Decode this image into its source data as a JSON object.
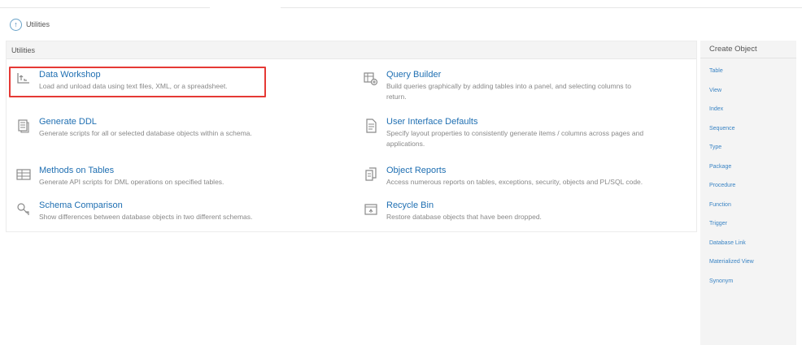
{
  "breadcrumb": {
    "label": "Utilities",
    "icon": "utilities-icon"
  },
  "panel": {
    "title": "Utilities",
    "items": [
      {
        "title": "Data Workshop",
        "desc1": "Load and unload data using text files, XML, or a spreadsheet.",
        "desc2": "",
        "icon": "data-workshop-icon",
        "highlighted": true
      },
      {
        "title": "Query Builder",
        "desc1": "Build queries graphically by adding tables into a panel, and selecting columns to",
        "desc2": "return.",
        "icon": "query-builder-icon"
      },
      {
        "title": "Generate DDL",
        "desc1": "Generate scripts for all or selected database objects within a schema.",
        "desc2": "",
        "icon": "generate-ddl-icon"
      },
      {
        "title": "User Interface Defaults",
        "desc1": "Specify layout properties to consistently generate items / columns across pages and",
        "desc2": "applications.",
        "icon": "ui-defaults-icon"
      },
      {
        "title": "Methods on Tables",
        "desc1": "Generate API scripts for DML operations on specified tables.",
        "desc2": "",
        "icon": "methods-on-tables-icon"
      },
      {
        "title": "Object Reports",
        "desc1": "Access numerous reports on tables, exceptions, security, objects and PL/SQL code.",
        "desc2": "",
        "icon": "object-reports-icon"
      },
      {
        "title": "Schema Comparison",
        "desc1": "Show differences between database objects in two different schemas.",
        "desc2": "",
        "icon": "schema-comparison-icon"
      },
      {
        "title": "Recycle Bin",
        "desc1": "Restore database objects that have been dropped.",
        "desc2": "",
        "icon": "recycle-bin-icon"
      }
    ]
  },
  "sidebar": {
    "title": "Create Object",
    "items": [
      "Table",
      "View",
      "Index",
      "Sequence",
      "Type",
      "Package",
      "Procedure",
      "Function",
      "Trigger",
      "Database Link",
      "Materialized View",
      "Synonym"
    ]
  },
  "colors": {
    "link": "#1f6fb2",
    "highlight": "#e53935",
    "sidebar_bg": "#f4f4f4"
  }
}
